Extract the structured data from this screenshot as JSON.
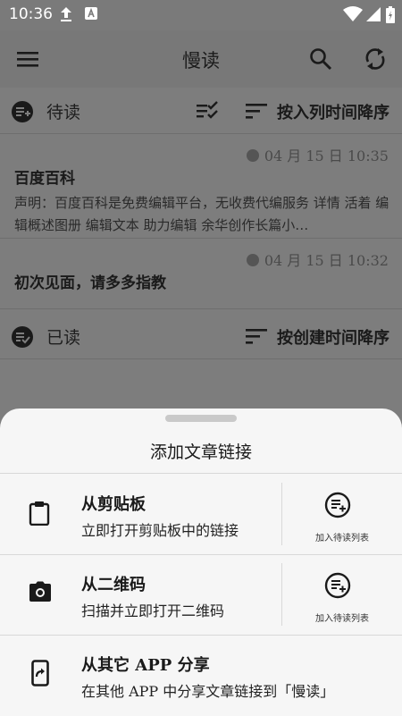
{
  "status_bar": {
    "time": "10:36"
  },
  "app_bar": {
    "title": "慢读"
  },
  "to_read_section": {
    "label": "待读",
    "sort_label": "按入列时间降序"
  },
  "articles": [
    {
      "date": "04 月 15 日 10:35",
      "title": "百度百科",
      "body": "声明：百度百科是免费编辑平台，无收费代编服务 详情 活着 编辑概述图册 编辑文本 助力编辑 余华创作长篇小…"
    },
    {
      "date": "04 月 15 日 10:32",
      "title": "初次见面，请多多指教"
    }
  ],
  "read_section": {
    "label": "已读",
    "sort_label": "按创建时间降序"
  },
  "sheet": {
    "title": "添加文章链接",
    "options": [
      {
        "title": "从剪贴板",
        "subtitle": "立即打开剪贴板中的链接",
        "add_label": "加入待读列表"
      },
      {
        "title": "从二维码",
        "subtitle": "扫描并立即打开二维码",
        "add_label": "加入待读列表"
      },
      {
        "title": "从其它 APP 分享",
        "subtitle": "在其他 APP 中分享文章链接到「慢读」"
      }
    ]
  },
  "colors": {
    "scrim": "#7d7d7d",
    "sheet_bg": "#f6f6f6",
    "icon_dark": "#1a1a1a"
  }
}
